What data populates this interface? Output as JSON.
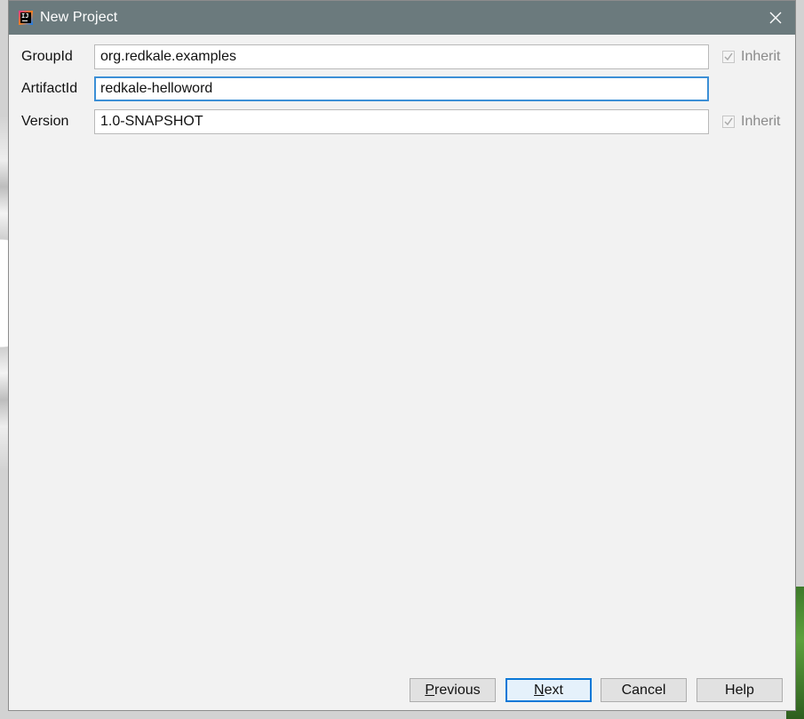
{
  "window": {
    "title": "New Project",
    "icon": "intellij-idea-icon"
  },
  "form": {
    "group_id": {
      "label": "GroupId",
      "value": "org.redkale.examples",
      "inherit_label": "Inherit",
      "inherit_checked": true,
      "inherit_enabled": false
    },
    "artifact_id": {
      "label": "ArtifactId",
      "value": "redkale-helloword"
    },
    "version": {
      "label": "Version",
      "value": "1.0-SNAPSHOT",
      "inherit_label": "Inherit",
      "inherit_checked": true,
      "inherit_enabled": false
    }
  },
  "buttons": {
    "previous": {
      "mnemonic": "P",
      "rest": "revious"
    },
    "next": {
      "mnemonic": "N",
      "rest": "ext"
    },
    "cancel": "Cancel",
    "help": "Help"
  },
  "colors": {
    "titlebar": "#6b7a7d",
    "focus": "#3c8fd6",
    "default_button": "#0a78d7",
    "dialog_bg": "#f2f2f2"
  }
}
